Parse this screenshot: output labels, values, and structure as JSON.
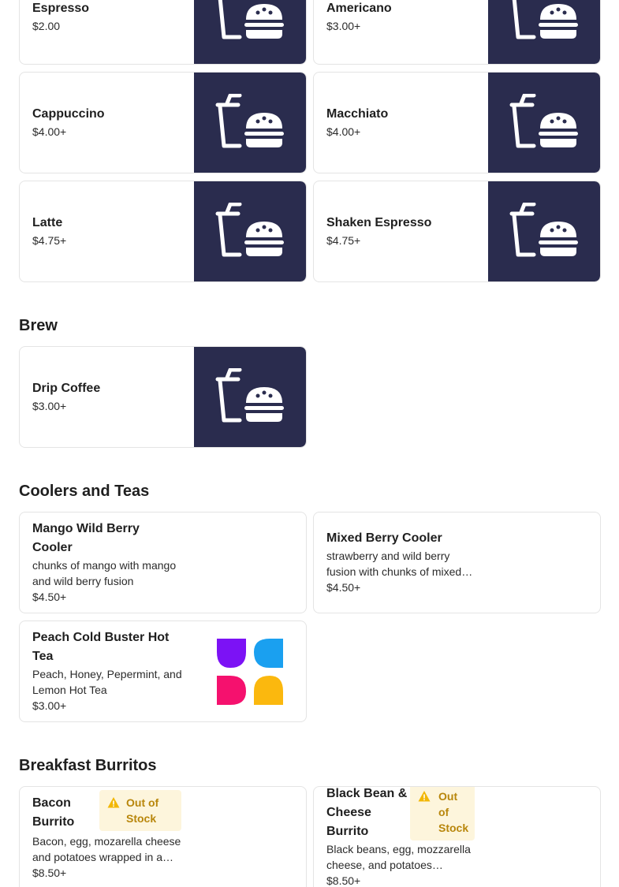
{
  "colors": {
    "thumb_bg": "#2a2c4e",
    "accent_warning": "#f2b705",
    "warning_bg": "#fdf5dc",
    "warning_text": "#b8860b"
  },
  "espresso_items": [
    {
      "name": "Espresso",
      "price": "$2.00"
    },
    {
      "name": "Americano",
      "price": "$3.00+"
    },
    {
      "name": "Cappuccino",
      "price": "$4.00+"
    },
    {
      "name": "Macchiato",
      "price": "$4.00+"
    },
    {
      "name": "Latte",
      "price": "$4.75+"
    },
    {
      "name": "Shaken Espresso",
      "price": "$4.75+"
    }
  ],
  "brew": {
    "title": "Brew",
    "items": [
      {
        "name": "Drip Coffee",
        "price": "$3.00+"
      }
    ]
  },
  "coolers": {
    "title": "Coolers and Teas",
    "items": [
      {
        "name": "Mango Wild Berry Cooler",
        "desc": "chunks of mango with mango and wild berry fusion",
        "price": "$4.50+"
      },
      {
        "name": "Mixed Berry Cooler",
        "desc": "strawberry and wild berry fusion with chunks of mixed berries",
        "price": "$4.50+"
      },
      {
        "name": "Peach Cold Buster Hot Tea",
        "desc": "Peach, Honey, Pepermint, and Lemon Hot Tea",
        "price": "$3.00+"
      }
    ]
  },
  "burritos": {
    "title": "Breakfast Burritos",
    "items": [
      {
        "name": "Bacon Burrito",
        "desc": "Bacon, egg, mozarella cheese and potatoes wrapped in a tortilla",
        "price": "$8.50+",
        "status": "Out of Stock"
      },
      {
        "name": "Black Bean & Cheese Burrito",
        "desc": "Black beans, egg, mozzarella cheese, and potatoes wrapped in a tortilla",
        "price": "$8.50+",
        "status": "Out of Stock"
      }
    ]
  },
  "icons": {
    "placeholder": "cup-and-burger-icon",
    "logo": "petal-logo-icon",
    "warning": "warning-icon"
  }
}
